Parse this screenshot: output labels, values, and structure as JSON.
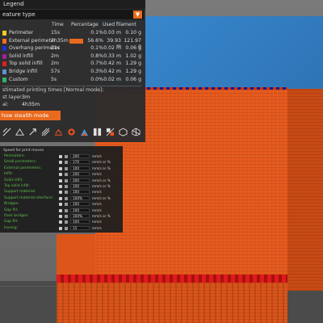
{
  "legend": {
    "title": "Legend",
    "view_type": "eature type",
    "columns": {
      "time": "Time",
      "percentage": "Percentage",
      "used_filament": "Used filament"
    },
    "items": [
      {
        "name": "Perimeter",
        "time": "15s",
        "percent": "0.1%",
        "length": "0.03 m",
        "weight": "0.10 g",
        "color": "#f0d020",
        "bar": 0.001
      },
      {
        "name": "External perimeter",
        "time": "2h35m",
        "percent": "56.6%",
        "length": "39.93 m",
        "weight": "121.97 g",
        "color": "#f07020",
        "bar": 0.566
      },
      {
        "name": "Overhang perimeter",
        "time": "21s",
        "percent": "0.1%",
        "length": "0.02 m",
        "weight": "0.06 g",
        "color": "#2030d0",
        "bar": 0.001
      },
      {
        "name": "Solid infill",
        "time": "2m",
        "percent": "0.8%",
        "length": "0.33 m",
        "weight": "1.02 g",
        "color": "#a020a0",
        "bar": 0.008
      },
      {
        "name": "Top solid infill",
        "time": "2m",
        "percent": "0.7%",
        "length": "0.42 m",
        "weight": "1.29 g",
        "color": "#e02020",
        "bar": 0.007
      },
      {
        "name": "Bridge infill",
        "time": "57s",
        "percent": "0.3%",
        "length": "0.42 m",
        "weight": "1.29 g",
        "color": "#6090d0",
        "bar": 0.003
      },
      {
        "name": "Custom",
        "time": "5s",
        "percent": "0.0%",
        "length": "0.02 m",
        "weight": "0.06 g",
        "color": "#30b070",
        "bar": 0.0
      }
    ],
    "estimated_title": "stimated printing times [Normal mode]:",
    "first_layer_label": "st layer:",
    "first_layer_value": "3m",
    "total_label": "al:",
    "total_value": "4h35m",
    "stealth_button": "how stealth mode"
  },
  "toolbar_icons": [
    "travel-icon",
    "wipe-icon",
    "retractions-icon",
    "deretractions-icon",
    "seams-icon",
    "tool-changes-icon",
    "color-changes-icon",
    "pause-prints-icon",
    "custom-gcodes-icon",
    "shells-icon",
    "tool-marker-icon"
  ],
  "params_panel": {
    "title": "Speed for print moves",
    "rows": [
      {
        "label": "Perimeters:",
        "value": "200",
        "unit": "mm/s"
      },
      {
        "label": "Small perimeters:",
        "value": "170",
        "unit": "mm/s or %"
      },
      {
        "label": "External perimeters:",
        "value": "100",
        "unit": "mm/s or %"
      },
      {
        "label": "Infill:",
        "value": "200",
        "unit": "mm/s"
      },
      {
        "label": "Solid infill:",
        "value": "200",
        "unit": "mm/s or %"
      },
      {
        "label": "Top solid infill:",
        "value": "100",
        "unit": "mm/s or %"
      },
      {
        "label": "Support material:",
        "value": "100",
        "unit": "mm/s"
      },
      {
        "label": "Support material interface:",
        "value": "100%",
        "unit": "mm/s or %"
      },
      {
        "label": "Bridges:",
        "value": "100",
        "unit": "mm/s"
      },
      {
        "label": "Gap fill:",
        "value": "100",
        "unit": "mm/s"
      },
      {
        "label": "Over bridges:",
        "value": "100%",
        "unit": "mm/s or %"
      },
      {
        "label": "Gap fill:",
        "value": "100",
        "unit": "mm/s"
      },
      {
        "label": "Ironing:",
        "value": "15",
        "unit": "mm/s"
      }
    ]
  }
}
